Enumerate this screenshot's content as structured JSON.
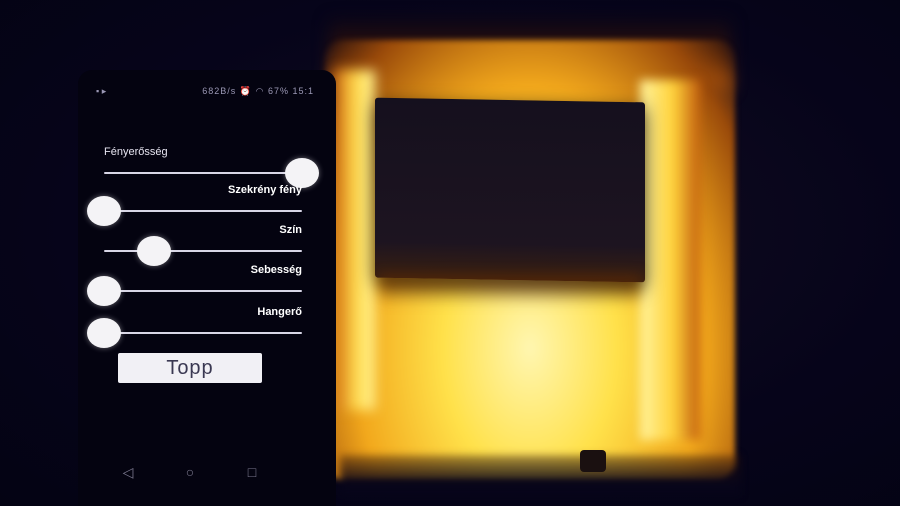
{
  "status": {
    "speed": "682B/s",
    "battery": "67%",
    "time": "15:1"
  },
  "sliders": [
    {
      "label": "Fényerősség",
      "value": 1.0,
      "label_side": "left"
    },
    {
      "label": "Szekrény fény",
      "value": 0.0,
      "label_side": "right"
    },
    {
      "label": "Szín",
      "value": 0.25,
      "label_side": "right"
    },
    {
      "label": "Sebesség",
      "value": 0.0,
      "label_side": "right"
    },
    {
      "label": "Hangerő",
      "value": 0.0,
      "label_side": "right"
    }
  ],
  "stop_button": {
    "label": "Topp"
  },
  "icons": {
    "back": "back-icon",
    "home": "home-icon",
    "recents": "recents-icon"
  },
  "colors": {
    "background": "#07051a",
    "glow": "#ffd23a",
    "thumb": "#f4f3f6"
  }
}
